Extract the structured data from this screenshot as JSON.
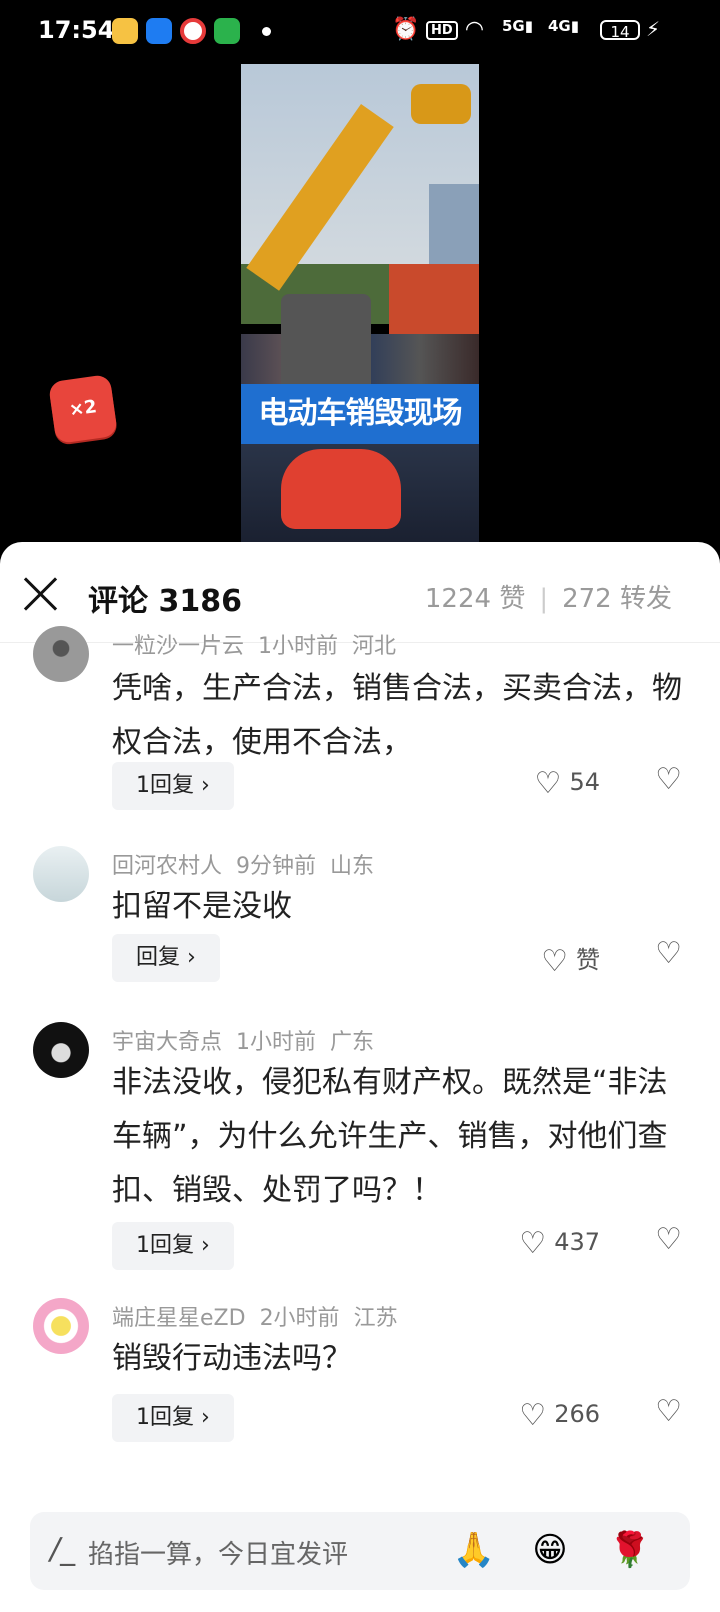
{
  "status_bar": {
    "time": "17:54",
    "battery": "14"
  },
  "video": {
    "banner_text": "电动车销毁现场"
  },
  "badge": {
    "label": "×2"
  },
  "sheet": {
    "title": "评论 3186",
    "likes": "1224 赞",
    "shares": "272 转发"
  },
  "comments": [
    {
      "user": "一粒沙一片云",
      "time": "1小时前",
      "location": "河北",
      "text": "凭啥，生产合法，销售合法，买卖合法，物权合法，使用不合法，",
      "reply": "1回复 ›",
      "likes": "54"
    },
    {
      "user": "回河农村人",
      "time": "9分钟前",
      "location": "山东",
      "text": "扣留不是没收",
      "reply": "回复 ›",
      "likes": "赞"
    },
    {
      "user": "宇宙大奇点",
      "time": "1小时前",
      "location": "广东",
      "text": "非法没收，侵犯私有财产权。既然是“非法车辆”，为什么允许生产、销售，对他们查扣、销毁、处罚了吗？！",
      "reply": "1回复 ›",
      "likes": "437"
    },
    {
      "user": "端庄星星eZD",
      "time": "2小时前",
      "location": "江苏",
      "text": "销毁行动违法吗？",
      "reply": "1回复 ›",
      "likes": "266"
    }
  ],
  "input": {
    "placeholder": "掐指一算，今日宜发评"
  },
  "icons": {
    "close": "close-icon",
    "heart": "heart-icon",
    "dislike": "broken-heart-icon",
    "pen": "pen-icon",
    "emoji_pray": "pray-emoji-icon",
    "emoji_grin": "grin-emoji-icon",
    "emoji_rose": "rose-emoji-icon"
  }
}
